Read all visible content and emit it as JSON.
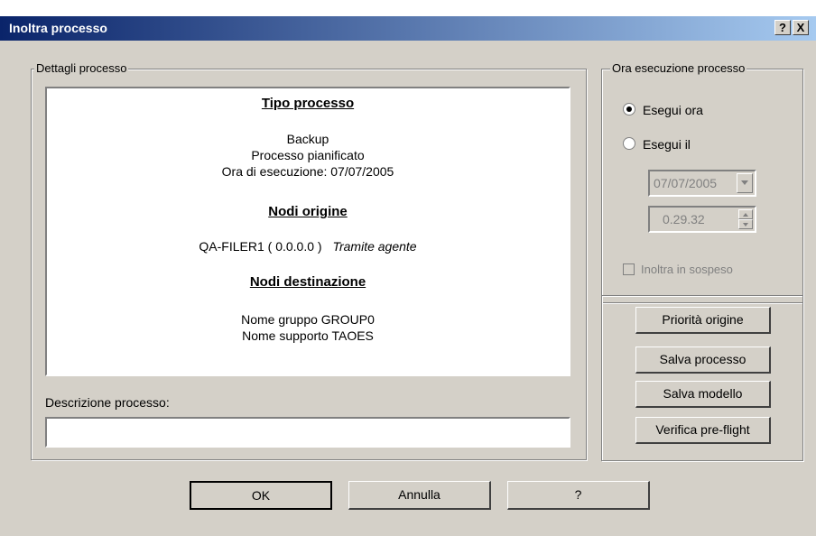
{
  "window": {
    "title": "Inoltra processo",
    "help_btn": "?",
    "close_btn": "X"
  },
  "details_group": {
    "title": "Dettagli processo",
    "job_type_heading": "Tipo processo",
    "job_type_lines": [
      "Backup",
      "Processo pianificato",
      "Ora di esecuzione:  07/07/2005"
    ],
    "source_heading": "Nodi origine",
    "source_node": "QA-FILER1 ( 0.0.0.0 )",
    "source_via": "Tramite agente",
    "dest_heading": "Nodi destinazione",
    "dest_lines": [
      "Nome gruppo   GROUP0",
      "Nome supporto   TAOES"
    ]
  },
  "description": {
    "label": "Descrizione processo:",
    "value": ""
  },
  "exec_group": {
    "title": "Ora esecuzione processo",
    "run_now": "Esegui ora",
    "run_at": "Esegui il",
    "date": "07/07/2005",
    "time": "0.29.32",
    "submit_hold": "Inoltra in sospeso",
    "selected": "run_now"
  },
  "side_buttons": [
    "Priorità origine",
    "Salva processo",
    "Salva modello",
    "Verifica pre-flight"
  ],
  "footer": {
    "ok": "OK",
    "cancel": "Annulla",
    "help": "?"
  },
  "colors": {
    "titlebar_start": "#0a246a",
    "titlebar_end": "#a6caf0",
    "dialog_bg": "#d4d0c8"
  }
}
